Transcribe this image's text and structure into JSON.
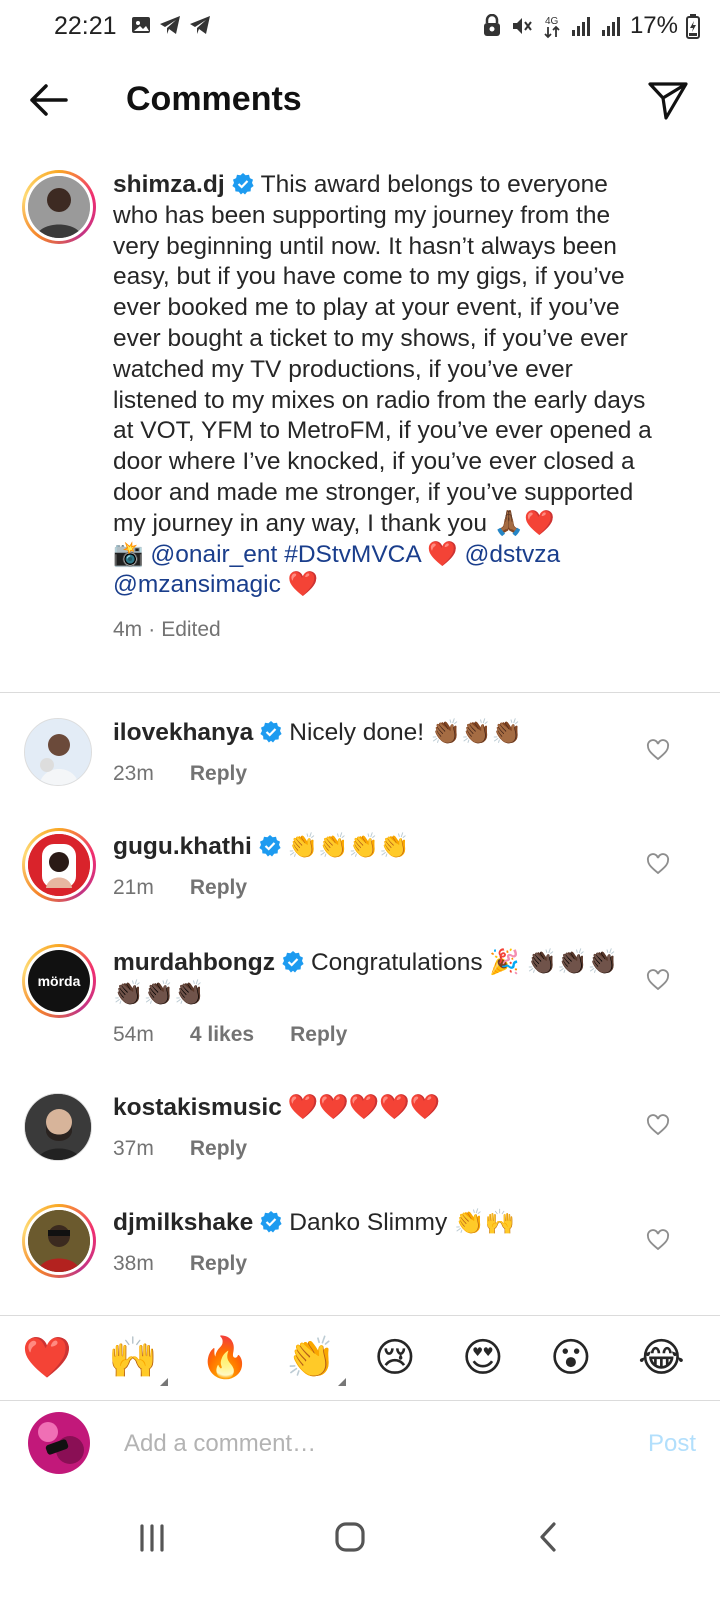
{
  "status_bar": {
    "time": "22:21",
    "battery": "17%",
    "network": "4G",
    "left_icons": [
      "gallery-icon",
      "telegram-icon",
      "telegram-icon"
    ],
    "right_icons": [
      "vpn-lock-icon",
      "mute-icon",
      "data-arrows-icon",
      "signal-icon",
      "signal-icon",
      "battery-charging-icon"
    ]
  },
  "header": {
    "title": "Comments",
    "back_icon": "arrow-left-icon",
    "share_icon": "send-icon"
  },
  "caption": {
    "username": "shimza.dj",
    "verified": true,
    "text": "This award belongs to everyone who has been supporting my journey from the very beginning until now. It hasn’t always been easy, but if you have come to my gigs, if you’ve ever booked me to play at your event, if you’ve ever bought a ticket to my shows, if you’ve ever watched my TV productions, if you’ve ever listened to my mixes on radio from the early days at VOT, YFM to MetroFM, if you’ve ever opened a door where I’ve knocked, if you’ve ever closed a door and made me stronger, if you’ve supported my journey in any way, I thank you 🙏🏾❤️",
    "camera_emoji": "📸",
    "mention1": "@onair_ent",
    "hashtag": "#DStvMVCA",
    "heart1": "❤️",
    "mention2": "@dstvza",
    "mention3": "@mzansimagic",
    "heart2": "❤️",
    "time": "4m",
    "sep": "·",
    "edited": "Edited"
  },
  "comments": [
    {
      "username": "ilovekhanya",
      "verified": true,
      "text": "Nicely done! 👏🏾👏🏾👏🏾",
      "time": "23m",
      "likes": "",
      "reply": "Reply"
    },
    {
      "username": "gugu.khathi",
      "verified": true,
      "text": "👏👏👏👏",
      "time": "21m",
      "likes": "",
      "reply": "Reply"
    },
    {
      "username": "murdahbongz",
      "verified": true,
      "text": "Congratulations 🎉 👏🏿👏🏿👏🏿👏🏿👏🏿👏🏿",
      "time": "54m",
      "likes": "4 likes",
      "reply": "Reply",
      "avatar_text": "mörda"
    },
    {
      "username": "kostakismusic",
      "verified": false,
      "text": "❤️❤️❤️❤️❤️",
      "time": "37m",
      "likes": "",
      "reply": "Reply"
    },
    {
      "username": "djmilkshake",
      "verified": true,
      "text": "Danko Slimmy 👏🙌",
      "time": "38m",
      "likes": "",
      "reply": "Reply"
    }
  ],
  "emoji_bar": [
    "❤️",
    "🙌",
    "🔥",
    "👏",
    "😢",
    "😍",
    "😮",
    "😂"
  ],
  "composer": {
    "placeholder": "Add a comment…",
    "post_label": "Post"
  },
  "navbar": {
    "icons": [
      "recent-apps-icon",
      "home-icon",
      "back-icon"
    ]
  },
  "colors": {
    "verified": "#1d9bf0",
    "mention": "#1a3e8c",
    "post_disabled": "#b2dffc",
    "meta_gray": "#737373"
  }
}
